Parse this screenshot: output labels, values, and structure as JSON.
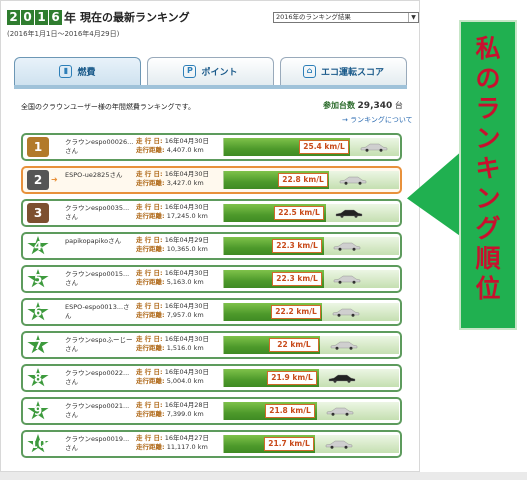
{
  "header": {
    "year_digits": [
      "2",
      "0",
      "1",
      "6"
    ],
    "year_label": "年",
    "title": "現在の最新ランキング",
    "period": "(2016年1月1日〜2016年4月29日)",
    "year_select": "2016年のランキング結果"
  },
  "tabs": [
    {
      "label": "燃費",
      "icon": "fuel-icon",
      "active": true
    },
    {
      "label": "ポイント",
      "icon": "points-icon",
      "active": false
    },
    {
      "label": "エコ運転スコア",
      "icon": "eco-score-icon",
      "active": false
    }
  ],
  "summary": {
    "description": "全国のクラウンユーザー様の年間燃費ランキングです。",
    "count_label": "参加台数",
    "count_value": "29,340",
    "count_unit": "台",
    "about_link": "→ ランキングについて"
  },
  "rows": [
    {
      "rank": "1",
      "medal": "gold",
      "name": "クラウンespo00026...さん",
      "date": "16年04月30日",
      "distance": "4,407.0 km",
      "value": "25.4",
      "unit": "km/L",
      "car": "silver",
      "fill": 0.72
    },
    {
      "rank": "2",
      "medal": "silver",
      "name": "ESPO-ue2825さん",
      "date": "16年04月30日",
      "distance": "3,427.0 km",
      "value": "22.8",
      "unit": "km/L",
      "car": "silver",
      "fill": 0.6,
      "me": true
    },
    {
      "rank": "3",
      "medal": "bronze",
      "name": "クラウンespo0035...さん",
      "date": "16年04月30日",
      "distance": "17,245.0 km",
      "value": "22.5",
      "unit": "km/L",
      "car": "black",
      "fill": 0.58
    },
    {
      "rank": "4",
      "medal": "star",
      "name": "papikopapikoさん",
      "date": "16年04月29日",
      "distance": "10,365.0 km",
      "value": "22.3",
      "unit": "km/L",
      "car": "silver",
      "fill": 0.57
    },
    {
      "rank": "5",
      "medal": "star",
      "name": "クラウンespo0015...さん",
      "date": "16年04月30日",
      "distance": "5,163.0 km",
      "value": "22.3",
      "unit": "km/L",
      "car": "silver",
      "fill": 0.57
    },
    {
      "rank": "6",
      "medal": "star",
      "name": "ESPO-espo0013...さん",
      "date": "16年04月30日",
      "distance": "7,957.0 km",
      "value": "22.2",
      "unit": "km/L",
      "car": "silver",
      "fill": 0.56
    },
    {
      "rank": "7",
      "medal": "star",
      "name": "クラウンespoふーじーさん",
      "date": "16年04月30日",
      "distance": "1,516.0 km",
      "value": "22",
      "unit": "km/L",
      "car": "silver",
      "fill": 0.55
    },
    {
      "rank": "8",
      "medal": "star",
      "name": "クラウンespo0022...さん",
      "date": "16年04月30日",
      "distance": "5,004.0 km",
      "value": "21.9",
      "unit": "km/L",
      "car": "black",
      "fill": 0.54
    },
    {
      "rank": "9",
      "medal": "star",
      "name": "クラウンespo0021...さん",
      "date": "16年04月28日",
      "distance": "7,399.0 km",
      "value": "21.8",
      "unit": "km/L",
      "car": "silver",
      "fill": 0.53
    },
    {
      "rank": "10",
      "medal": "star",
      "name": "クラウンespo0019...さん",
      "date": "16年04月27日",
      "distance": "11,117.0 km",
      "value": "21.7",
      "unit": "km/L",
      "car": "silver",
      "fill": 0.52
    }
  ],
  "labels": {
    "date_key": "走 行 日:",
    "distance_key": "走行距離:"
  },
  "callout": {
    "chars": [
      "私",
      "の",
      "ラ",
      "ン",
      "キ",
      "ン",
      "グ",
      "順",
      "位"
    ]
  },
  "colors": {
    "accent_green": "#20b050",
    "callout_text": "#c8102e",
    "bar_green": "#4e9a2b",
    "value_text": "#c84a1a"
  }
}
